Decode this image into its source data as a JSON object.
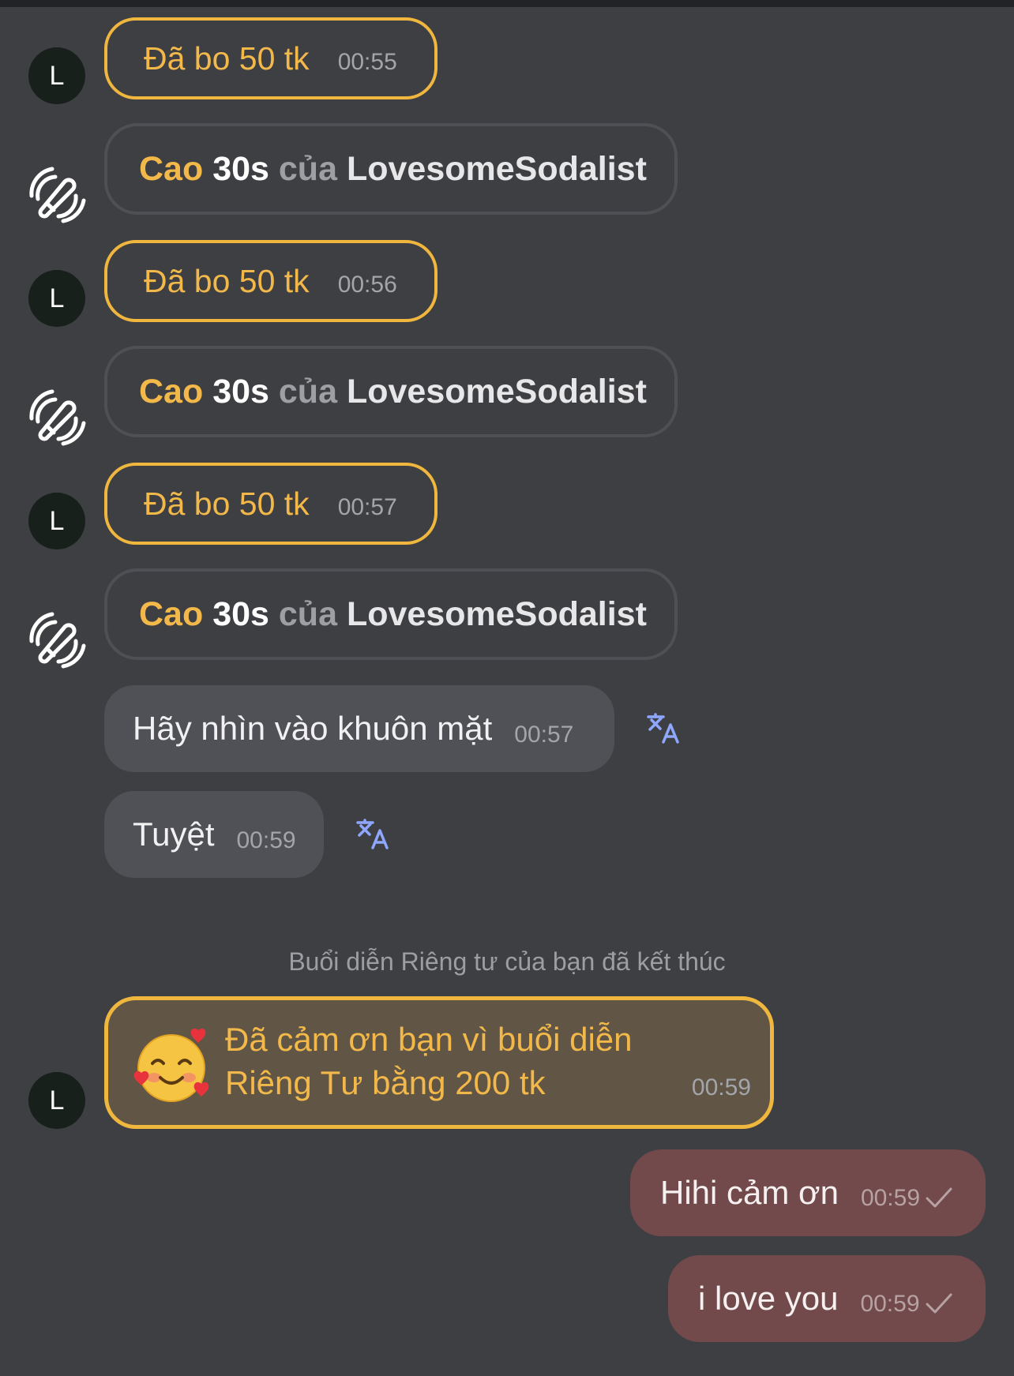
{
  "colors": {
    "background": "#3e3f43",
    "tip_border": "#f0b73e",
    "tip_text": "#f3b84a",
    "incoming_bubble": "#505156",
    "outgoing_bubble": "#724a4c",
    "translate_icon": "#8fa7ff"
  },
  "messages": [
    {
      "type": "tip",
      "avatar": "L",
      "text": "Đã bo 50 tk",
      "time": "00:55"
    },
    {
      "type": "toy",
      "icon": "toy-vibration-icon",
      "p1": "Cao",
      "p2": "30s",
      "p3": "của",
      "p4": "LovesomeSodalist"
    },
    {
      "type": "tip",
      "avatar": "L",
      "text": "Đã bo 50 tk",
      "time": "00:56"
    },
    {
      "type": "toy",
      "icon": "toy-vibration-icon",
      "p1": "Cao",
      "p2": "30s",
      "p3": "của",
      "p4": "LovesomeSodalist"
    },
    {
      "type": "tip",
      "avatar": "L",
      "text": "Đã bo 50 tk",
      "time": "00:57"
    },
    {
      "type": "toy",
      "icon": "toy-vibration-icon",
      "p1": "Cao",
      "p2": "30s",
      "p3": "của",
      "p4": "LovesomeSodalist"
    },
    {
      "type": "incoming",
      "text": "Hãy nhìn vào khuôn mặt",
      "time": "00:57",
      "icon": "translate-icon"
    },
    {
      "type": "incoming",
      "text": "Tuyệt",
      "time": "00:59",
      "icon": "translate-icon"
    }
  ],
  "system_message": "Buổi diễn Riêng tư của bạn đã kết thúc",
  "thanks_message": {
    "avatar": "L",
    "emoji": "smiling-face-with-hearts-icon",
    "line1": "Đã cảm ơn bạn vì buổi diễn",
    "line2": "Riêng Tư bằng 200 tk",
    "time": "00:59"
  },
  "outgoing": [
    {
      "text": "Hihi cảm ơn",
      "time": "00:59",
      "status": "sent-check-icon"
    },
    {
      "text": "i love you",
      "time": "00:59",
      "status": "sent-check-icon"
    }
  ]
}
